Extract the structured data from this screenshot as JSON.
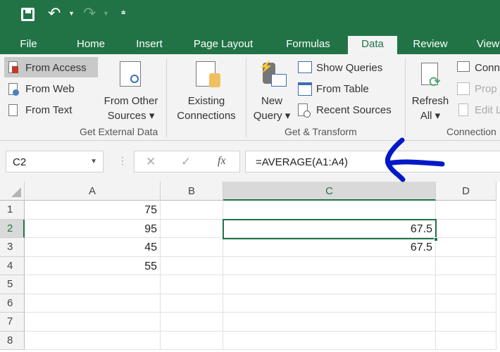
{
  "qat": {
    "save": "save-icon",
    "undo": "undo-icon",
    "redo": "redo-icon",
    "customize": "customize-icon"
  },
  "tabs": [
    "File",
    "Home",
    "Insert",
    "Page Layout",
    "Formulas",
    "Data",
    "Review",
    "View"
  ],
  "ribbon": {
    "from_access": "From Access",
    "from_web": "From Web",
    "from_text": "From Text",
    "from_other_1": "From Other",
    "from_other_2": "Sources ▾",
    "existing_1": "Existing",
    "existing_2": "Connections",
    "group1": "Get External Data",
    "new_query_1": "New",
    "new_query_2": "Query ▾",
    "show_queries": "Show Queries",
    "from_table": "From Table",
    "recent_sources": "Recent Sources",
    "group2": "Get & Transform",
    "refresh_1": "Refresh",
    "refresh_2": "All ▾",
    "connections": "Conn",
    "properties": "Prop",
    "edit_links": "Edit L",
    "group3": "Connection"
  },
  "formula_bar": {
    "name_box": "C2",
    "cancel": "✕",
    "enter": "✓",
    "fx": "fx",
    "formula": "=AVERAGE(A1:A4)"
  },
  "columns": [
    "A",
    "B",
    "C",
    "D"
  ],
  "rows": [
    "1",
    "2",
    "3",
    "4",
    "5",
    "6",
    "7",
    "8"
  ],
  "cells": {
    "A1": "75",
    "A2": "95",
    "A3": "45",
    "A4": "55",
    "C2": "67.5",
    "C3": "67.5"
  },
  "annotation_color": "#0019c8"
}
